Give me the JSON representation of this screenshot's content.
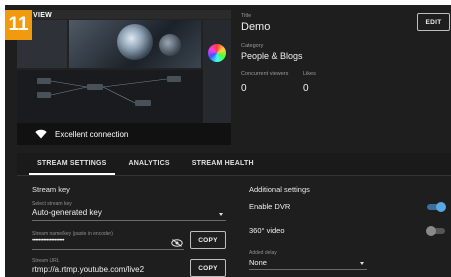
{
  "step": {
    "number": "11"
  },
  "preview": {
    "tag": "VIEW"
  },
  "connection": {
    "status": "Excellent connection"
  },
  "stream_info": {
    "title_label": "Title",
    "title": "Demo",
    "category_label": "Category",
    "category": "People & Blogs",
    "concurrent_viewers_label": "Concurrent viewers",
    "concurrent_viewers": "0",
    "likes_label": "Likes",
    "likes": "0",
    "edit_label": "EDIT"
  },
  "tabs": [
    {
      "label": "STREAM SETTINGS",
      "active": true
    },
    {
      "label": "ANALYTICS",
      "active": false
    },
    {
      "label": "STREAM HEALTH",
      "active": false
    }
  ],
  "stream_key": {
    "section_title": "Stream key",
    "select_label": "Select stream key",
    "select_value": "Auto-generated key",
    "key_label": "Stream name/key (paste in encoder)",
    "key_value": "••••••••••••••••••••",
    "copy_label": "COPY",
    "url_label": "Stream URL",
    "url_value": "rtmp://a.rtmp.youtube.com/live2",
    "url_copy_label": "COPY"
  },
  "additional": {
    "section_title": "Additional settings",
    "dvr_label": "Enable DVR",
    "dvr_enabled": true,
    "video360_label": "360° video",
    "video360_enabled": false,
    "delay_label": "Added delay",
    "delay_value": "None"
  },
  "colors": {
    "badge": "#f29a0e",
    "panel": "#1e1e1e",
    "toggle_on": "#5aa7e6"
  }
}
